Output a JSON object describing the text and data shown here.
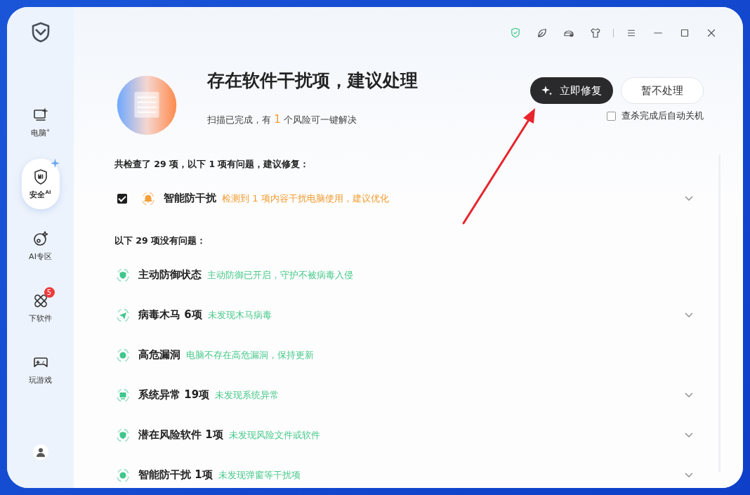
{
  "sidebar": {
    "items": [
      {
        "label": "电脑$^{+}$",
        "selected": false
      },
      {
        "label": "安全$^{AI}$",
        "selected": true
      },
      {
        "label": "AI专区",
        "selected": false
      },
      {
        "label": "下软件",
        "selected": false,
        "badge": "5"
      },
      {
        "label": "玩游戏",
        "selected": false
      }
    ]
  },
  "header": {
    "title": "存在软件干扰项，建议处理",
    "subtitle": {
      "before": "扫描已完成，有 ",
      "count": "1",
      "after": " 个风险可一键解决"
    },
    "primary_button": "立即修复",
    "secondary_button": "暂不处理",
    "shutdown_option": {
      "label": "查杀完成后自动关机",
      "checked": false
    }
  },
  "sections": [
    {
      "heading": "共检查了 29 项，以下 1 项有问题，建议修复：",
      "kind": "warning",
      "rows": [
        {
          "name": "智能防干扰",
          "detail": "检测到 1 项内容干扰电脑使用，建议优化",
          "checked": true,
          "expandable": true
        }
      ]
    },
    {
      "heading": "以下 29 项没有问题：",
      "kind": "ok",
      "rows": [
        {
          "name": "主动防御状态",
          "detail": "主动防御已开启，守护不被病毒入侵",
          "expandable": false
        },
        {
          "name": "病毒木马 6项",
          "detail": "未发现木马病毒",
          "expandable": true
        },
        {
          "name": "高危漏洞",
          "detail": "电脑不存在高危漏洞，保持更新",
          "expandable": false
        },
        {
          "name": "系统异常 19项",
          "detail": "未发现系统异常",
          "expandable": true
        },
        {
          "name": "潜在风险软件 1项",
          "detail": "未发现风险文件或软件",
          "expandable": true
        },
        {
          "name": "智能防干扰 1项",
          "detail": "未发现弹窗等干扰项",
          "expandable": true
        }
      ]
    }
  ]
}
